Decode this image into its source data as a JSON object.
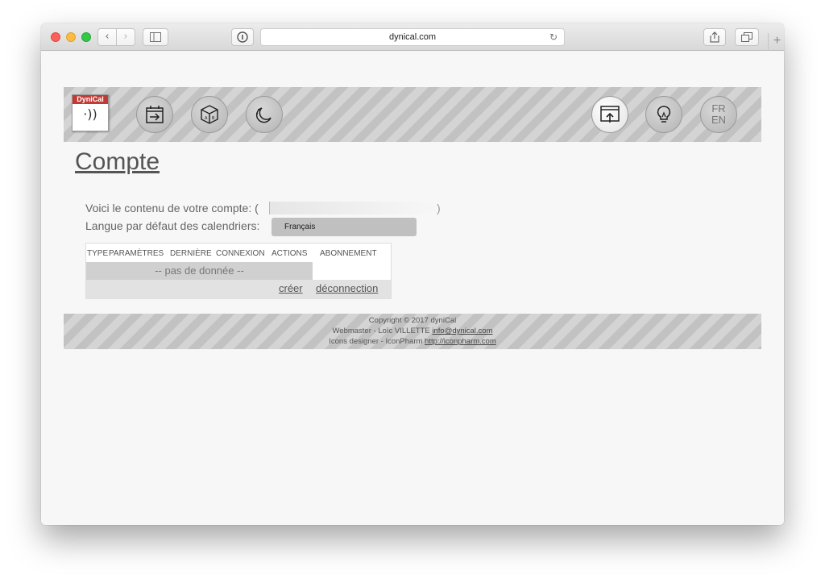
{
  "browser": {
    "url": "dynical.com",
    "back_glyph": "‹",
    "forward_glyph": "›",
    "new_tab_glyph": "+"
  },
  "header": {
    "logo_text": "DyniCal",
    "logo_waves": "·))",
    "lang_fr": "FR",
    "lang_en": "EN",
    "icons": [
      "calendar-export-icon",
      "cube-icon",
      "moon-icon",
      "window-export-icon",
      "lightbulb-icon"
    ]
  },
  "page": {
    "title": "Compte",
    "account_text": "Voici le contenu de votre compte: (",
    "account_close": ")",
    "language_label": "Langue par défaut des calendriers:",
    "language_value": "Français"
  },
  "table": {
    "columns": [
      "TYPE",
      "PARAMÈTRES",
      "DERNIÈRE",
      "CONNEXION",
      "ACTIONS",
      "ABONNEMENT"
    ],
    "no_data": "-- pas de donnée --",
    "create_link": "créer",
    "logout_link": "déconnection"
  },
  "footer": {
    "copyright": "Copyright © 2017 dyniCal",
    "webmaster_label": "Webmaster - Loïc VILLETTE",
    "webmaster_email": "info@dynical.com",
    "icons_label": "Icons designer - IconPharm",
    "icons_url": "http://iconpharm.com"
  },
  "colors": {
    "close": "#fc605b",
    "minimize": "#fdbc40",
    "maximize": "#34c84a",
    "logo_red": "#c23a36"
  }
}
